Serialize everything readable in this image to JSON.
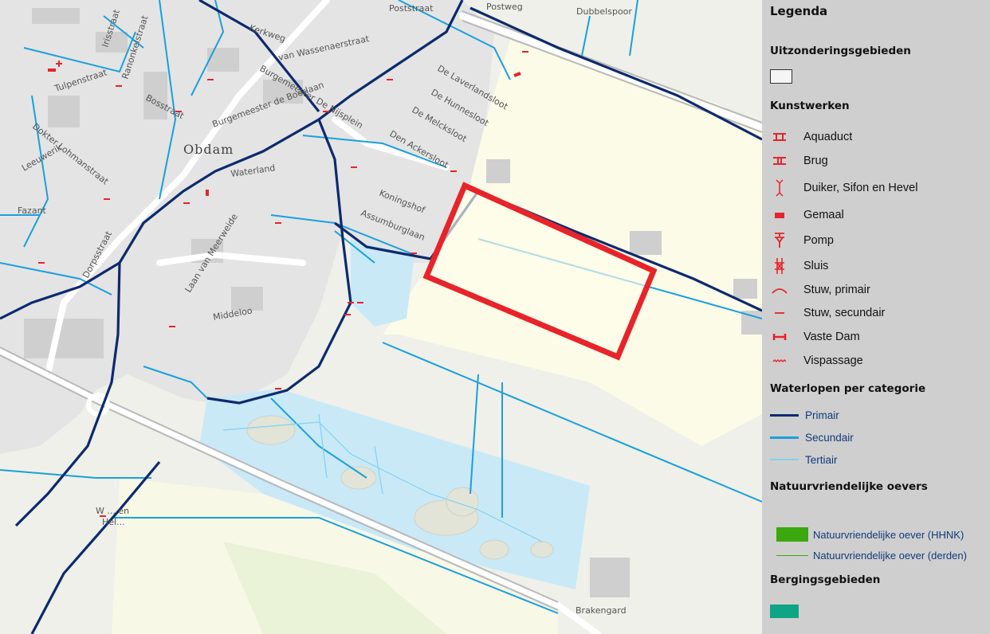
{
  "map": {
    "place_labels": {
      "obdam": "Obdam",
      "brakengard": "Brakengard",
      "weel": "W ... en",
      "weel2": "Hel..."
    },
    "street_labels": {
      "postweg": "Postweg",
      "poststraat": "Poststraat",
      "dubbelspoor": "Dubbelspoor",
      "kerkweg": "Kerkweg",
      "irisstraat": "Irisstraat",
      "ranonkelstraat": "Ranonkelstraat",
      "van_wassenaer": "van Wassenaerstraat",
      "bgm_nijssen": "Burgemeester De Nijsplein",
      "bgm_boerlaan": "Burgemeester de Boerlaan",
      "tulpenstraat": "Tulpenstraat",
      "bosstraat": "Bosstraat",
      "lohmanstraat": "Dokter Lohmanstraat",
      "leeuwerik": "Leeuwerik",
      "fazant": "Fazant",
      "dorpsstraat": "Dorpsstraat",
      "waterland": "Waterland",
      "laan_meerweide": "Laan van Meerweide",
      "middeloo": "Middeloo",
      "koningshof": "Koningshof",
      "assumburglaan": "Assumburglaan",
      "den_ackersloot": "Den Ackersloot",
      "de_melcksloot": "De Melcksloot",
      "de_hunnesloot": "De Hunnesloot",
      "de_laverlandsloot": "De Laverlandsloot"
    }
  },
  "legend": {
    "title": "Legenda",
    "sections": {
      "uitzondering": "Uitzonderingsgebieden",
      "kunstwerken": "Kunstwerken",
      "waterlopen": "Waterlopen per categorie",
      "oevers": "Natuurvriendelijke oevers",
      "berging": "Bergingsgebieden"
    },
    "kunstwerken": [
      {
        "label": "Aquaduct",
        "icon": "aquaduct-icon"
      },
      {
        "label": "Brug",
        "icon": "brug-icon"
      },
      {
        "label": "Duiker, Sifon en Hevel",
        "icon": "duiker-icon"
      },
      {
        "label": "Gemaal",
        "icon": "gemaal-icon"
      },
      {
        "label": "Pomp",
        "icon": "pomp-icon"
      },
      {
        "label": "Sluis",
        "icon": "sluis-icon"
      },
      {
        "label": "Stuw, primair",
        "icon": "stuw-primair-icon"
      },
      {
        "label": "Stuw, secundair",
        "icon": "stuw-secundair-icon"
      },
      {
        "label": "Vaste Dam",
        "icon": "vaste-dam-icon"
      },
      {
        "label": "Vispassage",
        "icon": "vispassage-icon"
      }
    ],
    "waterlopen": [
      {
        "label": "Primair",
        "color": "#0d2a6e"
      },
      {
        "label": "Secundair",
        "color": "#1aa0dc"
      },
      {
        "label": "Tertiair",
        "color": "#7fd3f0"
      }
    ],
    "oevers": [
      {
        "label": "Natuurvriendelijke oever (HHNK)",
        "color": "#3aa80e"
      },
      {
        "label": "Natuurvriendelijke oever (derden)",
        "color": "#3aa80e"
      }
    ],
    "colors": {
      "structure_red": "#e8232a",
      "highlight_red": "#e8232a",
      "berging": "#0ea585"
    }
  }
}
